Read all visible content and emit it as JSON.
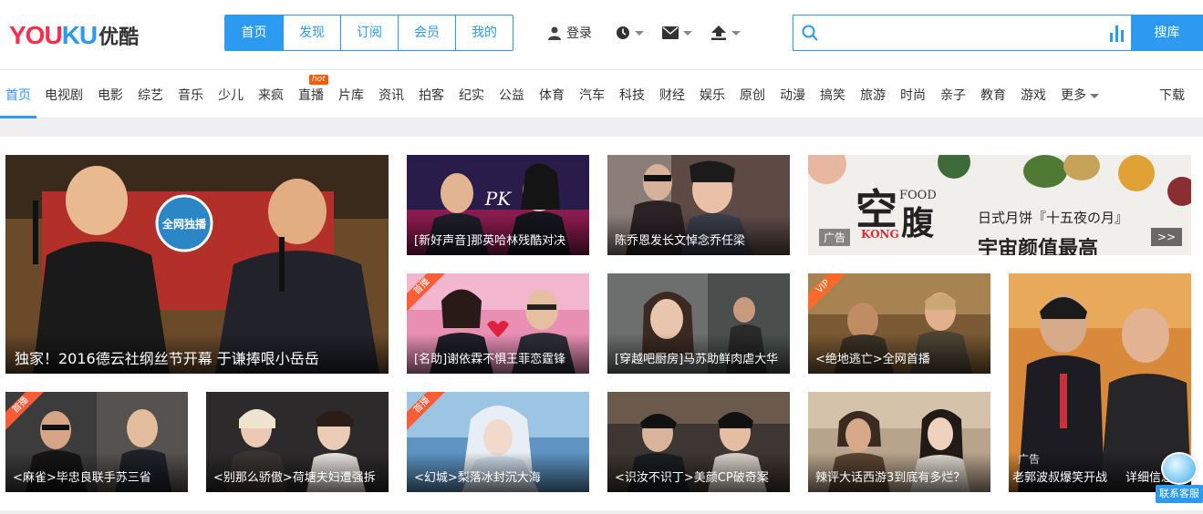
{
  "logo": {
    "en_part1": "YOU",
    "en_part2": "KU",
    "cn": "优酷"
  },
  "main_tabs": [
    {
      "label": "首页",
      "active": true
    },
    {
      "label": "发现"
    },
    {
      "label": "订阅"
    },
    {
      "label": "会员"
    },
    {
      "label": "我的"
    }
  ],
  "user": {
    "login_label": "登录"
  },
  "icons": [
    "user-icon",
    "clock-icon",
    "mail-icon",
    "upload-icon",
    "search-icon",
    "voice-bars-icon"
  ],
  "search": {
    "placeholder": "",
    "button_label": "搜库"
  },
  "colors": {
    "accent": "#2d9af2",
    "hot": "#ff5a00",
    "corner_badge": "#ff5c38"
  },
  "channels": [
    "首页",
    "电视剧",
    "电影",
    "综艺",
    "音乐",
    "少儿",
    "来疯",
    "直播",
    "片库",
    "资讯",
    "拍客",
    "纪实",
    "公益",
    "体育",
    "汽车",
    "科技",
    "财经",
    "娱乐",
    "原创",
    "动漫",
    "搞笑",
    "旅游",
    "时尚",
    "亲子",
    "教育",
    "游戏",
    "更多",
    "下载"
  ],
  "hot_badge": "hot",
  "tiles": {
    "hero": {
      "caption": "独家！2016德云社纲丝节开幕 于谦捧哏小岳岳",
      "badge": "全网独播"
    },
    "t1": {
      "caption": "[新好声音]那英哈林残酷对决",
      "overlay": "PK"
    },
    "t2": {
      "caption": "陈乔恩发长文悼念乔任梁"
    },
    "ad": {
      "big_char": "空",
      "big_char2": "腹",
      "food": "FOOD",
      "kong": "KONG",
      "sub": "日式月饼『十五夜の月』",
      "main": "宇宙颜值最高",
      "tag": "广告",
      "next": ">>"
    },
    "t3": {
      "caption": "[名助]谢依霖不惧王菲恋霆锋",
      "corner": "首播"
    },
    "t4": {
      "caption": "[穿越吧厨房]马苏助鲜肉虐大华"
    },
    "t5": {
      "caption": "<绝地逃亡>全网首播",
      "corner": "VIP"
    },
    "tall": {
      "tag": "广告",
      "caption_left": "老郭波叔爆笑开战",
      "caption_right": "详细信息"
    },
    "b1": {
      "caption": "<麻雀>毕忠良联手苏三省",
      "corner": "首播"
    },
    "b2": {
      "caption": "<别那么骄傲>荷塘夫妇遭强拆"
    },
    "b3": {
      "caption": "<幻城>梨落冰封沉大海",
      "corner": "首播"
    },
    "b4": {
      "caption": "<识汝不识丁>美颜CP破奇案"
    },
    "b5": {
      "caption": "辣评大话西游3到底有多烂？"
    }
  },
  "service": {
    "label": "联系客服"
  }
}
